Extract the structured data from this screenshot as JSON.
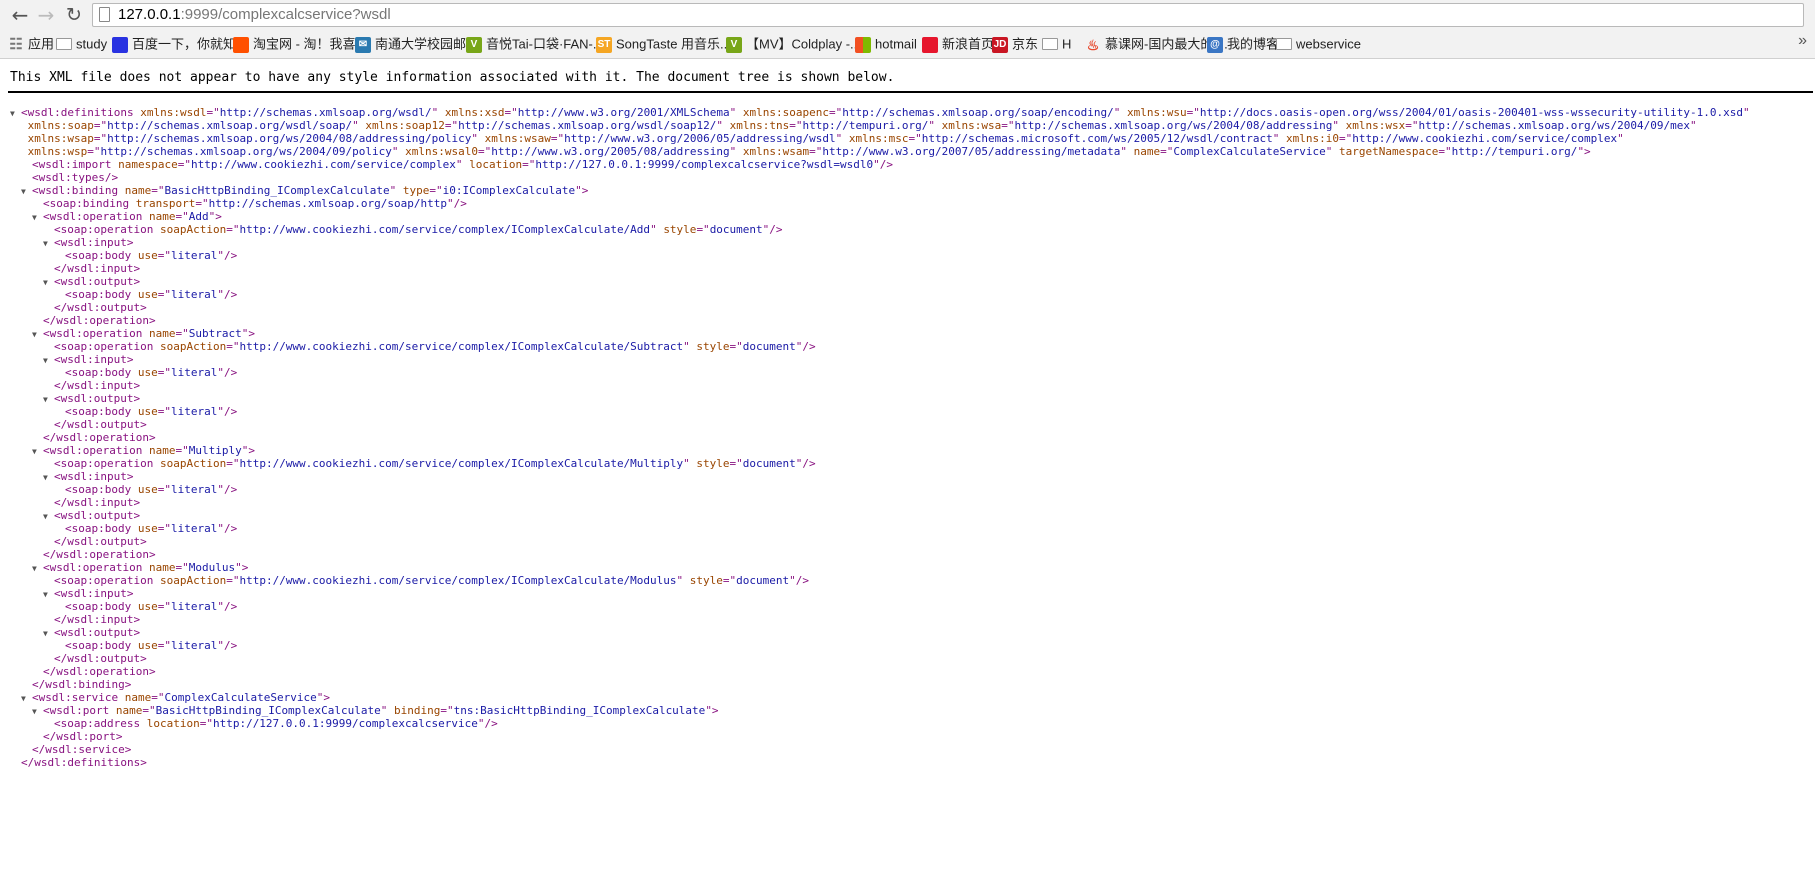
{
  "browser": {
    "url_host": "127.0.0.1",
    "url_rest": ":9999/complexcalcservice?wsdl",
    "icons": {
      "back": "back-arrow-icon",
      "forward": "forward-arrow-icon",
      "reload": "reload-icon",
      "page": "page-icon"
    }
  },
  "bookmarks": [
    {
      "label": "应用",
      "icon": "apps-grid-icon",
      "color": "#888888"
    },
    {
      "label": "study",
      "icon": "folder-icon",
      "color": ""
    },
    {
      "label": "百度一下，你就知道",
      "icon": "baidu-paw-icon",
      "color": "#2932e1"
    },
    {
      "label": "淘宝网 - 淘！我喜欢",
      "icon": "taobao-icon",
      "color": "#ff5000"
    },
    {
      "label": "南通大学校园邮箱",
      "icon": "mail-icon",
      "color": "#2a7ab0"
    },
    {
      "label": "音悦Tai-口袋·FAN-...",
      "icon": "yinyuetai-icon",
      "color": "#78a618"
    },
    {
      "label": "SongTaste 用音乐...",
      "icon": "songtaste-icon",
      "color": "#f5a623"
    },
    {
      "label": "【MV】Coldplay -...",
      "icon": "yinyuetai-icon",
      "color": "#78a618"
    },
    {
      "label": "hotmail",
      "icon": "windows-icon",
      "color": "#f25022"
    },
    {
      "label": "新浪首页",
      "icon": "weibo-icon",
      "color": "#e6162d"
    },
    {
      "label": "京东",
      "icon": "jd-icon",
      "color": "#c91623"
    },
    {
      "label": "H",
      "icon": "folder-icon",
      "color": ""
    },
    {
      "label": "慕课网-国内最大的I...",
      "icon": "flame-icon",
      "color": "#e84a2e"
    },
    {
      "label": "我的博客",
      "icon": "blog-icon",
      "color": "#3a76c4"
    },
    {
      "label": "webservice",
      "icon": "folder-icon",
      "color": ""
    }
  ],
  "info_message": "This XML file does not appear to have any style information associated with it. The document tree is shown below.",
  "xml_lines": [
    {
      "i": 0,
      "t": true,
      "p": [
        [
          "t",
          "<wsdl:definitions "
        ],
        [
          "n",
          "xmlns:wsdl"
        ],
        [
          "t",
          "=\""
        ],
        [
          "v",
          "http://schemas.xmlsoap.org/wsdl/"
        ],
        [
          "t",
          "\" "
        ],
        [
          "n",
          "xmlns:xsd"
        ],
        [
          "t",
          "=\""
        ],
        [
          "v",
          "http://www.w3.org/2001/XMLSchema"
        ],
        [
          "t",
          "\" "
        ],
        [
          "n",
          "xmlns:soapenc"
        ],
        [
          "t",
          "=\""
        ],
        [
          "v",
          "http://schemas.xmlsoap.org/soap/encoding/"
        ],
        [
          "t",
          "\" "
        ],
        [
          "n",
          "xmlns:wsu"
        ],
        [
          "t",
          "=\""
        ],
        [
          "v",
          "http://docs.oasis-open.org/wss/2004/01/oasis-200401-wss-wssecurity-utility-1.0.xsd"
        ],
        [
          "t",
          "\""
        ]
      ]
    },
    {
      "i": 0,
      "t": false,
      "p": [
        [
          "t",
          " "
        ],
        [
          "n",
          "xmlns:soap"
        ],
        [
          "t",
          "=\""
        ],
        [
          "v",
          "http://schemas.xmlsoap.org/wsdl/soap/"
        ],
        [
          "t",
          "\" "
        ],
        [
          "n",
          "xmlns:soap12"
        ],
        [
          "t",
          "=\""
        ],
        [
          "v",
          "http://schemas.xmlsoap.org/wsdl/soap12/"
        ],
        [
          "t",
          "\" "
        ],
        [
          "n",
          "xmlns:tns"
        ],
        [
          "t",
          "=\""
        ],
        [
          "v",
          "http://tempuri.org/"
        ],
        [
          "t",
          "\" "
        ],
        [
          "n",
          "xmlns:wsa"
        ],
        [
          "t",
          "=\""
        ],
        [
          "v",
          "http://schemas.xmlsoap.org/ws/2004/08/addressing"
        ],
        [
          "t",
          "\" "
        ],
        [
          "n",
          "xmlns:wsx"
        ],
        [
          "t",
          "=\""
        ],
        [
          "v",
          "http://schemas.xmlsoap.org/ws/2004/09/mex"
        ],
        [
          "t",
          "\""
        ]
      ]
    },
    {
      "i": 0,
      "t": false,
      "p": [
        [
          "t",
          " "
        ],
        [
          "n",
          "xmlns:wsap"
        ],
        [
          "t",
          "=\""
        ],
        [
          "v",
          "http://schemas.xmlsoap.org/ws/2004/08/addressing/policy"
        ],
        [
          "t",
          "\" "
        ],
        [
          "n",
          "xmlns:wsaw"
        ],
        [
          "t",
          "=\""
        ],
        [
          "v",
          "http://www.w3.org/2006/05/addressing/wsdl"
        ],
        [
          "t",
          "\" "
        ],
        [
          "n",
          "xmlns:msc"
        ],
        [
          "t",
          "=\""
        ],
        [
          "v",
          "http://schemas.microsoft.com/ws/2005/12/wsdl/contract"
        ],
        [
          "t",
          "\" "
        ],
        [
          "n",
          "xmlns:i0"
        ],
        [
          "t",
          "=\""
        ],
        [
          "v",
          "http://www.cookiezhi.com/service/complex"
        ],
        [
          "t",
          "\""
        ]
      ]
    },
    {
      "i": 0,
      "t": false,
      "p": [
        [
          "t",
          " "
        ],
        [
          "n",
          "xmlns:wsp"
        ],
        [
          "t",
          "=\""
        ],
        [
          "v",
          "http://schemas.xmlsoap.org/ws/2004/09/policy"
        ],
        [
          "t",
          "\" "
        ],
        [
          "n",
          "xmlns:wsal0"
        ],
        [
          "t",
          "=\""
        ],
        [
          "v",
          "http://www.w3.org/2005/08/addressing"
        ],
        [
          "t",
          "\" "
        ],
        [
          "n",
          "xmlns:wsam"
        ],
        [
          "t",
          "=\""
        ],
        [
          "v",
          "http://www.w3.org/2007/05/addressing/metadata"
        ],
        [
          "t",
          "\" "
        ],
        [
          "n",
          "name"
        ],
        [
          "t",
          "=\""
        ],
        [
          "v",
          "ComplexCalculateService"
        ],
        [
          "t",
          "\" "
        ],
        [
          "n",
          "targetNamespace"
        ],
        [
          "t",
          "=\""
        ],
        [
          "v",
          "http://tempuri.org/"
        ],
        [
          "t",
          "\">"
        ]
      ]
    },
    {
      "i": 1,
      "t": false,
      "p": [
        [
          "t",
          "<wsdl:import "
        ],
        [
          "n",
          "namespace"
        ],
        [
          "t",
          "=\""
        ],
        [
          "v",
          "http://www.cookiezhi.com/service/complex"
        ],
        [
          "t",
          "\" "
        ],
        [
          "n",
          "location"
        ],
        [
          "t",
          "=\""
        ],
        [
          "v",
          "http://127.0.0.1:9999/complexcalcservice?wsdl=wsdl0"
        ],
        [
          "t",
          "\"/>"
        ]
      ]
    },
    {
      "i": 1,
      "t": false,
      "p": [
        [
          "t",
          "<wsdl:types/>"
        ]
      ]
    },
    {
      "i": 1,
      "t": true,
      "p": [
        [
          "t",
          "<wsdl:binding "
        ],
        [
          "n",
          "name"
        ],
        [
          "t",
          "=\""
        ],
        [
          "v",
          "BasicHttpBinding_IComplexCalculate"
        ],
        [
          "t",
          "\" "
        ],
        [
          "n",
          "type"
        ],
        [
          "t",
          "=\""
        ],
        [
          "v",
          "i0:IComplexCalculate"
        ],
        [
          "t",
          "\">"
        ]
      ]
    },
    {
      "i": 2,
      "t": false,
      "p": [
        [
          "t",
          "<soap:binding "
        ],
        [
          "n",
          "transport"
        ],
        [
          "t",
          "=\""
        ],
        [
          "v",
          "http://schemas.xmlsoap.org/soap/http"
        ],
        [
          "t",
          "\"/>"
        ]
      ]
    },
    {
      "i": 2,
      "t": true,
      "p": [
        [
          "t",
          "<wsdl:operation "
        ],
        [
          "n",
          "name"
        ],
        [
          "t",
          "=\""
        ],
        [
          "v",
          "Add"
        ],
        [
          "t",
          "\">"
        ]
      ]
    },
    {
      "i": 3,
      "t": false,
      "p": [
        [
          "t",
          "<soap:operation "
        ],
        [
          "n",
          "soapAction"
        ],
        [
          "t",
          "=\""
        ],
        [
          "v",
          "http://www.cookiezhi.com/service/complex/IComplexCalculate/Add"
        ],
        [
          "t",
          "\" "
        ],
        [
          "n",
          "style"
        ],
        [
          "t",
          "=\""
        ],
        [
          "v",
          "document"
        ],
        [
          "t",
          "\"/>"
        ]
      ]
    },
    {
      "i": 3,
      "t": true,
      "p": [
        [
          "t",
          "<wsdl:input>"
        ]
      ]
    },
    {
      "i": 4,
      "t": false,
      "p": [
        [
          "t",
          "<soap:body "
        ],
        [
          "n",
          "use"
        ],
        [
          "t",
          "=\""
        ],
        [
          "v",
          "literal"
        ],
        [
          "t",
          "\"/>"
        ]
      ]
    },
    {
      "i": 3,
      "t": false,
      "p": [
        [
          "t",
          "</wsdl:input>"
        ]
      ]
    },
    {
      "i": 3,
      "t": true,
      "p": [
        [
          "t",
          "<wsdl:output>"
        ]
      ]
    },
    {
      "i": 4,
      "t": false,
      "p": [
        [
          "t",
          "<soap:body "
        ],
        [
          "n",
          "use"
        ],
        [
          "t",
          "=\""
        ],
        [
          "v",
          "literal"
        ],
        [
          "t",
          "\"/>"
        ]
      ]
    },
    {
      "i": 3,
      "t": false,
      "p": [
        [
          "t",
          "</wsdl:output>"
        ]
      ]
    },
    {
      "i": 2,
      "t": false,
      "p": [
        [
          "t",
          "</wsdl:operation>"
        ]
      ]
    },
    {
      "i": 2,
      "t": true,
      "p": [
        [
          "t",
          "<wsdl:operation "
        ],
        [
          "n",
          "name"
        ],
        [
          "t",
          "=\""
        ],
        [
          "v",
          "Subtract"
        ],
        [
          "t",
          "\">"
        ]
      ]
    },
    {
      "i": 3,
      "t": false,
      "p": [
        [
          "t",
          "<soap:operation "
        ],
        [
          "n",
          "soapAction"
        ],
        [
          "t",
          "=\""
        ],
        [
          "v",
          "http://www.cookiezhi.com/service/complex/IComplexCalculate/Subtract"
        ],
        [
          "t",
          "\" "
        ],
        [
          "n",
          "style"
        ],
        [
          "t",
          "=\""
        ],
        [
          "v",
          "document"
        ],
        [
          "t",
          "\"/>"
        ]
      ]
    },
    {
      "i": 3,
      "t": true,
      "p": [
        [
          "t",
          "<wsdl:input>"
        ]
      ]
    },
    {
      "i": 4,
      "t": false,
      "p": [
        [
          "t",
          "<soap:body "
        ],
        [
          "n",
          "use"
        ],
        [
          "t",
          "=\""
        ],
        [
          "v",
          "literal"
        ],
        [
          "t",
          "\"/>"
        ]
      ]
    },
    {
      "i": 3,
      "t": false,
      "p": [
        [
          "t",
          "</wsdl:input>"
        ]
      ]
    },
    {
      "i": 3,
      "t": true,
      "p": [
        [
          "t",
          "<wsdl:output>"
        ]
      ]
    },
    {
      "i": 4,
      "t": false,
      "p": [
        [
          "t",
          "<soap:body "
        ],
        [
          "n",
          "use"
        ],
        [
          "t",
          "=\""
        ],
        [
          "v",
          "literal"
        ],
        [
          "t",
          "\"/>"
        ]
      ]
    },
    {
      "i": 3,
      "t": false,
      "p": [
        [
          "t",
          "</wsdl:output>"
        ]
      ]
    },
    {
      "i": 2,
      "t": false,
      "p": [
        [
          "t",
          "</wsdl:operation>"
        ]
      ]
    },
    {
      "i": 2,
      "t": true,
      "p": [
        [
          "t",
          "<wsdl:operation "
        ],
        [
          "n",
          "name"
        ],
        [
          "t",
          "=\""
        ],
        [
          "v",
          "Multiply"
        ],
        [
          "t",
          "\">"
        ]
      ]
    },
    {
      "i": 3,
      "t": false,
      "p": [
        [
          "t",
          "<soap:operation "
        ],
        [
          "n",
          "soapAction"
        ],
        [
          "t",
          "=\""
        ],
        [
          "v",
          "http://www.cookiezhi.com/service/complex/IComplexCalculate/Multiply"
        ],
        [
          "t",
          "\" "
        ],
        [
          "n",
          "style"
        ],
        [
          "t",
          "=\""
        ],
        [
          "v",
          "document"
        ],
        [
          "t",
          "\"/>"
        ]
      ]
    },
    {
      "i": 3,
      "t": true,
      "p": [
        [
          "t",
          "<wsdl:input>"
        ]
      ]
    },
    {
      "i": 4,
      "t": false,
      "p": [
        [
          "t",
          "<soap:body "
        ],
        [
          "n",
          "use"
        ],
        [
          "t",
          "=\""
        ],
        [
          "v",
          "literal"
        ],
        [
          "t",
          "\"/>"
        ]
      ]
    },
    {
      "i": 3,
      "t": false,
      "p": [
        [
          "t",
          "</wsdl:input>"
        ]
      ]
    },
    {
      "i": 3,
      "t": true,
      "p": [
        [
          "t",
          "<wsdl:output>"
        ]
      ]
    },
    {
      "i": 4,
      "t": false,
      "p": [
        [
          "t",
          "<soap:body "
        ],
        [
          "n",
          "use"
        ],
        [
          "t",
          "=\""
        ],
        [
          "v",
          "literal"
        ],
        [
          "t",
          "\"/>"
        ]
      ]
    },
    {
      "i": 3,
      "t": false,
      "p": [
        [
          "t",
          "</wsdl:output>"
        ]
      ]
    },
    {
      "i": 2,
      "t": false,
      "p": [
        [
          "t",
          "</wsdl:operation>"
        ]
      ]
    },
    {
      "i": 2,
      "t": true,
      "p": [
        [
          "t",
          "<wsdl:operation "
        ],
        [
          "n",
          "name"
        ],
        [
          "t",
          "=\""
        ],
        [
          "v",
          "Modulus"
        ],
        [
          "t",
          "\">"
        ]
      ]
    },
    {
      "i": 3,
      "t": false,
      "p": [
        [
          "t",
          "<soap:operation "
        ],
        [
          "n",
          "soapAction"
        ],
        [
          "t",
          "=\""
        ],
        [
          "v",
          "http://www.cookiezhi.com/service/complex/IComplexCalculate/Modulus"
        ],
        [
          "t",
          "\" "
        ],
        [
          "n",
          "style"
        ],
        [
          "t",
          "=\""
        ],
        [
          "v",
          "document"
        ],
        [
          "t",
          "\"/>"
        ]
      ]
    },
    {
      "i": 3,
      "t": true,
      "p": [
        [
          "t",
          "<wsdl:input>"
        ]
      ]
    },
    {
      "i": 4,
      "t": false,
      "p": [
        [
          "t",
          "<soap:body "
        ],
        [
          "n",
          "use"
        ],
        [
          "t",
          "=\""
        ],
        [
          "v",
          "literal"
        ],
        [
          "t",
          "\"/>"
        ]
      ]
    },
    {
      "i": 3,
      "t": false,
      "p": [
        [
          "t",
          "</wsdl:input>"
        ]
      ]
    },
    {
      "i": 3,
      "t": true,
      "p": [
        [
          "t",
          "<wsdl:output>"
        ]
      ]
    },
    {
      "i": 4,
      "t": false,
      "p": [
        [
          "t",
          "<soap:body "
        ],
        [
          "n",
          "use"
        ],
        [
          "t",
          "=\""
        ],
        [
          "v",
          "literal"
        ],
        [
          "t",
          "\"/>"
        ]
      ]
    },
    {
      "i": 3,
      "t": false,
      "p": [
        [
          "t",
          "</wsdl:output>"
        ]
      ]
    },
    {
      "i": 2,
      "t": false,
      "p": [
        [
          "t",
          "</wsdl:operation>"
        ]
      ]
    },
    {
      "i": 1,
      "t": false,
      "p": [
        [
          "t",
          "</wsdl:binding>"
        ]
      ]
    },
    {
      "i": 1,
      "t": true,
      "p": [
        [
          "t",
          "<wsdl:service "
        ],
        [
          "n",
          "name"
        ],
        [
          "t",
          "=\""
        ],
        [
          "v",
          "ComplexCalculateService"
        ],
        [
          "t",
          "\">"
        ]
      ]
    },
    {
      "i": 2,
      "t": true,
      "p": [
        [
          "t",
          "<wsdl:port "
        ],
        [
          "n",
          "name"
        ],
        [
          "t",
          "=\""
        ],
        [
          "v",
          "BasicHttpBinding_IComplexCalculate"
        ],
        [
          "t",
          "\" "
        ],
        [
          "n",
          "binding"
        ],
        [
          "t",
          "=\""
        ],
        [
          "v",
          "tns:BasicHttpBinding_IComplexCalculate"
        ],
        [
          "t",
          "\">"
        ]
      ]
    },
    {
      "i": 3,
      "t": false,
      "p": [
        [
          "t",
          "<soap:address "
        ],
        [
          "n",
          "location"
        ],
        [
          "t",
          "=\""
        ],
        [
          "v",
          "http://127.0.0.1:9999/complexcalcservice"
        ],
        [
          "t",
          "\"/>"
        ]
      ]
    },
    {
      "i": 2,
      "t": false,
      "p": [
        [
          "t",
          "</wsdl:port>"
        ]
      ]
    },
    {
      "i": 1,
      "t": false,
      "p": [
        [
          "t",
          "</wsdl:service>"
        ]
      ]
    },
    {
      "i": 0,
      "t": false,
      "p": [
        [
          "t",
          "</wsdl:definitions>"
        ]
      ]
    }
  ]
}
